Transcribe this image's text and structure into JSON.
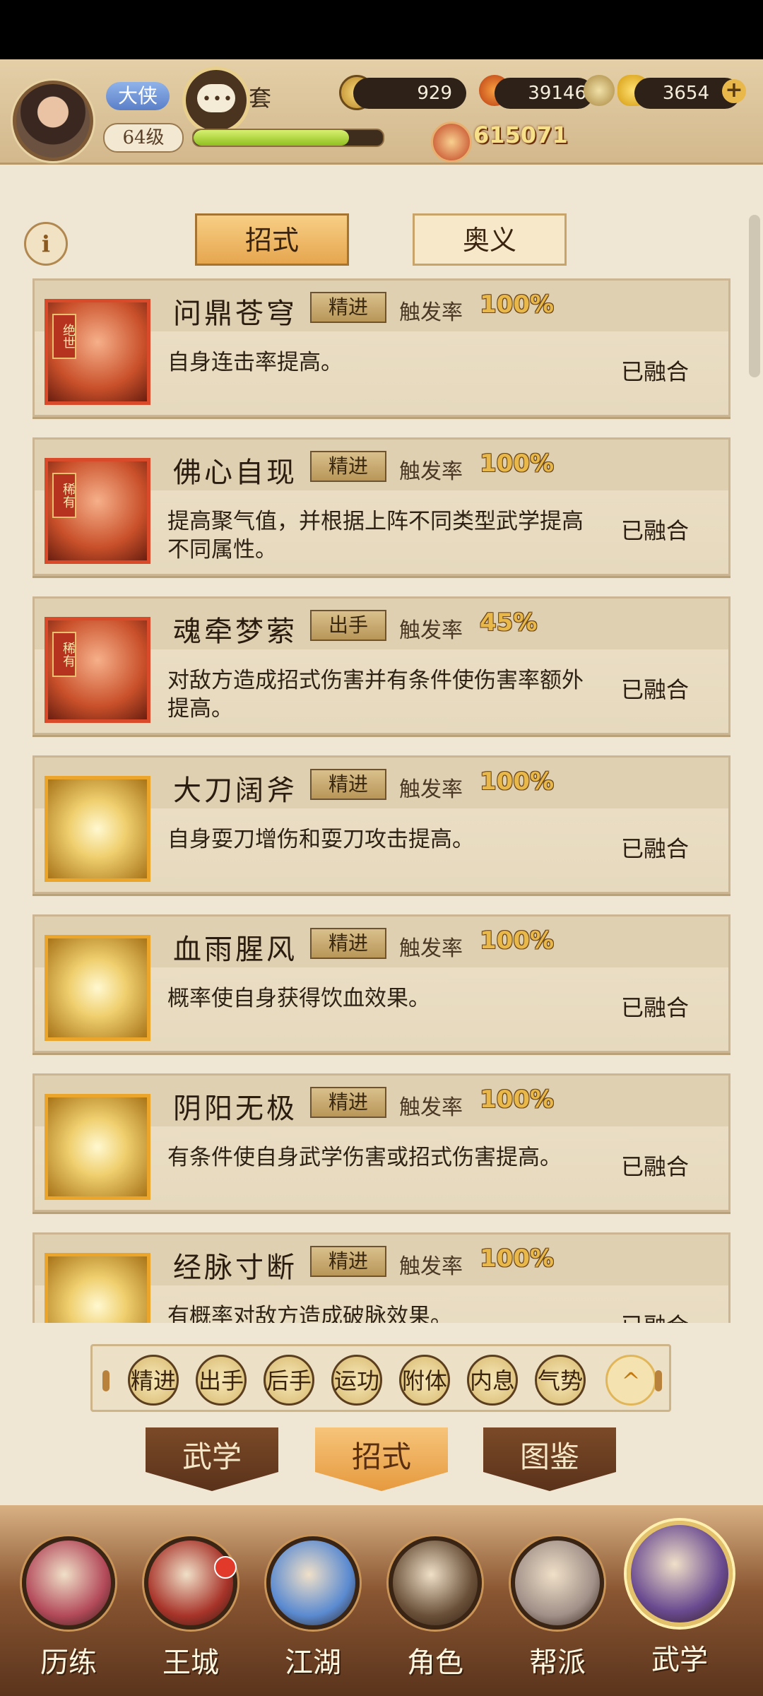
{
  "header": {
    "title_badge": "大侠",
    "player_name": "套",
    "level": "64级",
    "exp_fraction": 0.82,
    "resources": [
      {
        "icon": "copper-coin-icon",
        "value": "929"
      },
      {
        "icon": "flame-token-icon",
        "value": "39146"
      },
      {
        "icon": "gold-ingot-icon",
        "value": "3654"
      }
    ],
    "combat_power": "615071",
    "chat_dots": "•••"
  },
  "tabs": {
    "info": "i",
    "active": "招式",
    "inactive": "奥义"
  },
  "trigger_label": "触发率",
  "skills": [
    {
      "name": "问鼎苍穹",
      "tag": "精进",
      "rate": "100%",
      "desc": "自身连击率提高。",
      "status": "已融合",
      "rank": "绝世",
      "frame": "red"
    },
    {
      "name": "佛心自现",
      "tag": "精进",
      "rate": "100%",
      "desc": "提高聚气值，并根据上阵不同类型武学提高不同属性。",
      "status": "已融合",
      "rank": "稀有",
      "frame": "red"
    },
    {
      "name": "魂牵梦萦",
      "tag": "出手",
      "rate": "45%",
      "desc": "对敌方造成招式伤害并有条件使伤害率额外提高。",
      "status": "已融合",
      "rank": "稀有",
      "frame": "red"
    },
    {
      "name": "大刀阔斧",
      "tag": "精进",
      "rate": "100%",
      "desc": "自身耍刀增伤和耍刀攻击提高。",
      "status": "已融合",
      "rank": "",
      "frame": "gold"
    },
    {
      "name": "血雨腥风",
      "tag": "精进",
      "rate": "100%",
      "desc": "概率使自身获得饮血效果。",
      "status": "已融合",
      "rank": "",
      "frame": "gold"
    },
    {
      "name": "阴阳无极",
      "tag": "精进",
      "rate": "100%",
      "desc": "有条件使自身武学伤害或招式伤害提高。",
      "status": "已融合",
      "rank": "",
      "frame": "gold"
    },
    {
      "name": "经脉寸断",
      "tag": "精进",
      "rate": "100%",
      "desc": "有概率对敌方造成破脉效果。",
      "status": "已融合",
      "rank": "",
      "frame": "gold"
    }
  ],
  "filters": [
    "精进",
    "出手",
    "后手",
    "运功",
    "附体",
    "内息",
    "气势"
  ],
  "filter_toggle": "^",
  "subtabs": [
    "武学",
    "招式",
    "图鉴"
  ],
  "bottom_nav": [
    {
      "label": "历练",
      "color": "#b34a5a"
    },
    {
      "label": "王城",
      "color": "#a8342a"
    },
    {
      "label": "江湖",
      "color": "#5a8ad0"
    },
    {
      "label": "角色",
      "color": "#6a5038"
    },
    {
      "label": "帮派",
      "color": "#a09088"
    },
    {
      "label": "武学",
      "color": "#6a4a90"
    }
  ]
}
